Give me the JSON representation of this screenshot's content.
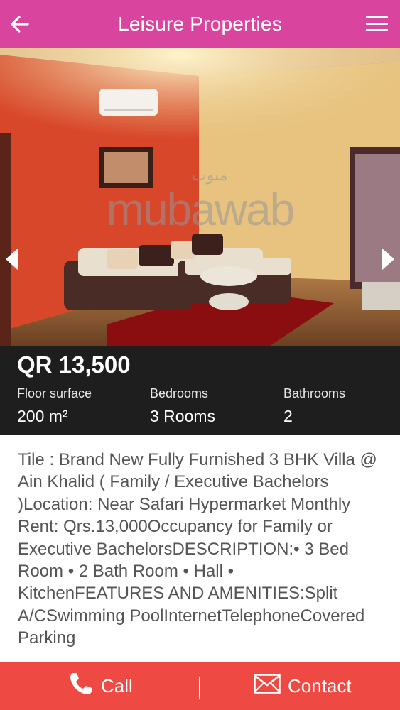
{
  "header": {
    "title": "Leisure Properties",
    "back_icon": "arrow-left-icon",
    "menu_icon": "hamburger-menu-icon"
  },
  "gallery": {
    "watermark_text": "mubawab",
    "watermark_arabic": "مبوب",
    "prev_icon": "chevron-left-icon",
    "next_icon": "chevron-right-icon"
  },
  "summary": {
    "price": "QR 13,500",
    "stats": [
      {
        "label": "Floor surface",
        "value": "200 m²"
      },
      {
        "label": "Bedrooms",
        "value": "3 Rooms"
      },
      {
        "label": "Bathrooms",
        "value": "2"
      }
    ]
  },
  "description": "Tile : Brand New Fully Furnished 3 BHK Villa @ Ain Khalid ( Family / Executive Bachelors )Location: Near Safari Hypermarket Monthly Rent: Qrs.13,000Occupancy for Family or Executive BachelorsDESCRIPTION:• 3 Bed Room • 2 Bath Room • Hall • KitchenFEATURES AND AMENITIES:Split A/CSwimming PoolInternetTelephoneCovered Parking",
  "actions": {
    "call_label": "Call",
    "contact_label": "Contact",
    "call_icon": "phone-icon",
    "contact_icon": "envelope-icon"
  },
  "colors": {
    "header_bg": "#d9449e",
    "summary_bg": "#1e1e1e",
    "action_bar_bg": "#ee4a43",
    "description_text": "#555555"
  }
}
